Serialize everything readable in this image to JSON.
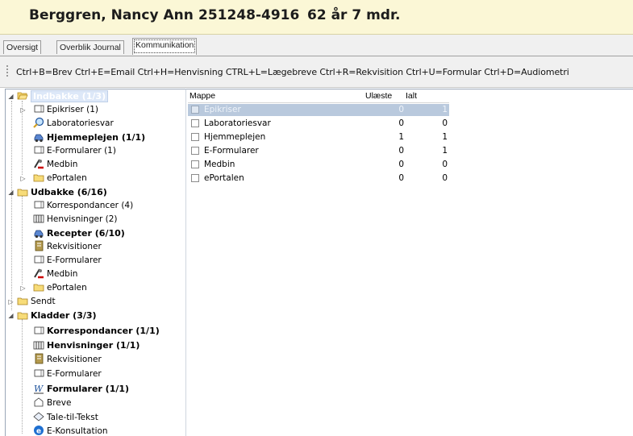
{
  "header": {
    "patient_name": "Berggren, Nancy Ann",
    "cpr": "251248-4916",
    "age": "62 år 7 mdr."
  },
  "tabs": [
    {
      "label": "Oversigt",
      "active": false
    },
    {
      "label": "Overblik Journal",
      "active": false
    },
    {
      "label": "Kommunikation",
      "active": true
    }
  ],
  "shortcuts": "Ctrl+B=Brev  Ctrl+E=Email  Ctrl+H=Henvisning  CTRL+L=Lægebreve  Ctrl+R=Rekvisition  Ctrl+U=Formular  Ctrl+D=Audiometri",
  "tree": {
    "indbakke": {
      "label": "Indbakke (1/3)",
      "children": [
        "Epikriser (1)",
        "Laboratoriesvar",
        "Hjemmeplejen (1/1)",
        "E-Formularer (1)",
        "Medbin",
        "ePortalen"
      ]
    },
    "udbakke": {
      "label": "Udbakke (6/16)",
      "children": [
        "Korrespondancer (4)",
        "Henvisninger (2)",
        "Recepter (6/10)",
        "Rekvisitioner",
        "E-Formularer",
        "Medbin",
        "ePortalen"
      ]
    },
    "sendt": {
      "label": "Sendt"
    },
    "kladder": {
      "label": "Kladder (3/3)",
      "children": [
        "Korrespondancer (1/1)",
        "Henvisninger (1/1)",
        "Rekvisitioner",
        "E-Formularer",
        "Formularer (1/1)",
        "Breve",
        "Tale-til-Tekst",
        "E-Konsultation"
      ]
    }
  },
  "grid": {
    "headers": {
      "folder": "Mappe",
      "unread": "Ulæste",
      "total": "Ialt"
    },
    "rows": [
      {
        "name": "Epikriser",
        "unread": "0",
        "total": "1",
        "selected": true
      },
      {
        "name": "Laboratoriesvar",
        "unread": "0",
        "total": "0"
      },
      {
        "name": "Hjemmeplejen",
        "unread": "1",
        "total": "1"
      },
      {
        "name": "E-Formularer",
        "unread": "0",
        "total": "1"
      },
      {
        "name": "Medbin",
        "unread": "0",
        "total": "0"
      },
      {
        "name": "ePortalen",
        "unread": "0",
        "total": "0"
      }
    ]
  },
  "colors": {
    "header_bg": "#fbf7d6",
    "selection": "#b9c9dd",
    "bold_link": "#000000"
  }
}
